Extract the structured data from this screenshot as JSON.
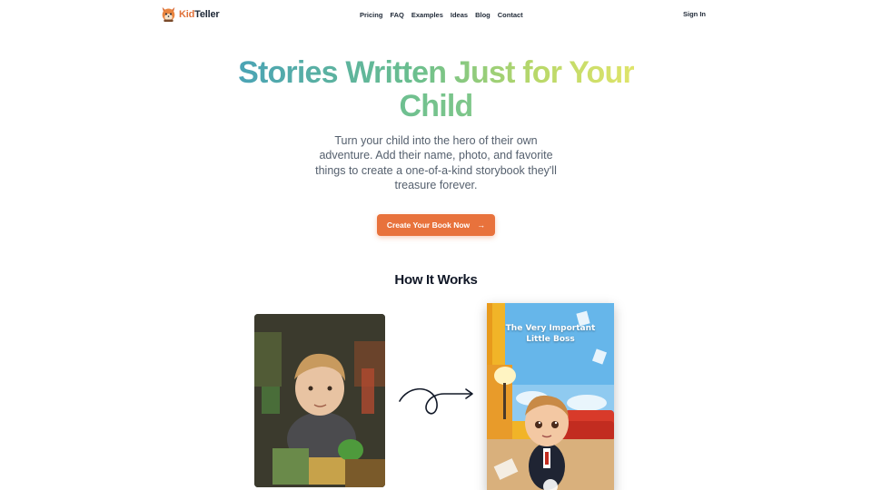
{
  "brand": {
    "part1": "Kid",
    "part2": "Teller"
  },
  "nav": {
    "links": [
      "Pricing",
      "FAQ",
      "Examples",
      "Ideas",
      "Blog",
      "Contact"
    ],
    "sign_in": "Sign In"
  },
  "hero": {
    "title_line1": "Stories Written Just for Your",
    "title_line2": "Child",
    "subtitle": "Turn your child into the hero of their own adventure. Add their name, photo, and favorite things to create a one-of-a-kind storybook they'll treasure forever.",
    "cta_label": "Create Your Book Now",
    "cta_icon": "arrow-right-icon"
  },
  "how_it_works": {
    "title": "How It Works",
    "book_title": "The Very Important Little Boss"
  },
  "colors": {
    "accent": "#e8723c",
    "gradient_start": "#4aa3b5",
    "gradient_end": "#dfe46a"
  }
}
